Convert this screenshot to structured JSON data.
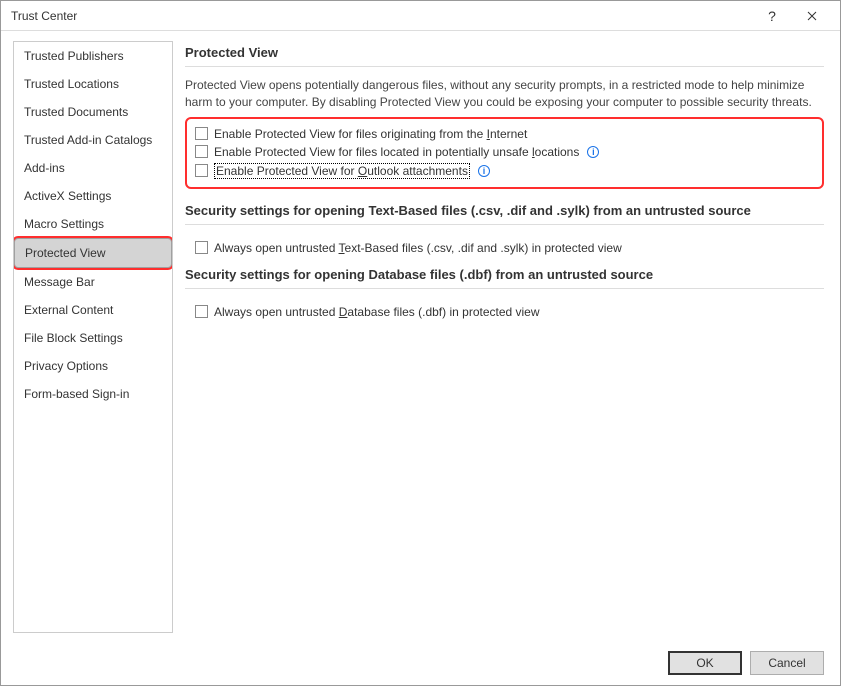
{
  "window": {
    "title": "Trust Center"
  },
  "sidebar": {
    "items": [
      {
        "label": "Trusted Publishers"
      },
      {
        "label": "Trusted Locations"
      },
      {
        "label": "Trusted Documents"
      },
      {
        "label": "Trusted Add-in Catalogs"
      },
      {
        "label": "Add-ins"
      },
      {
        "label": "ActiveX Settings"
      },
      {
        "label": "Macro Settings"
      },
      {
        "label": "Protected View"
      },
      {
        "label": "Message Bar"
      },
      {
        "label": "External Content"
      },
      {
        "label": "File Block Settings"
      },
      {
        "label": "Privacy Options"
      },
      {
        "label": "Form-based Sign-in"
      }
    ]
  },
  "main": {
    "heading": "Protected View",
    "description": "Protected View opens potentially dangerous files, without any security prompts, in a restricted mode to help minimize harm to your computer. By disabling Protected View you could be exposing your computer to possible security threats.",
    "opt1_pre": "Enable Protected View for files originating from the ",
    "opt1_u": "I",
    "opt1_post": "nternet",
    "opt2_pre": "Enable Protected View for files located in potentially unsafe ",
    "opt2_u": "l",
    "opt2_post": "ocations",
    "opt3_pre": "Enable Protected View for ",
    "opt3_u": "O",
    "opt3_post": "utlook attachments",
    "sec2_heading": "Security settings for opening Text-Based files (.csv, .dif and .sylk) from an untrusted source",
    "sec2_opt_pre": "Always open untrusted ",
    "sec2_opt_u": "T",
    "sec2_opt_post": "ext-Based files (.csv, .dif and .sylk) in protected view",
    "sec3_heading": "Security settings for opening Database files (.dbf) from an untrusted source",
    "sec3_opt_pre": "Always open untrusted ",
    "sec3_opt_u": "D",
    "sec3_opt_post": "atabase files (.dbf) in protected view"
  },
  "footer": {
    "ok": "OK",
    "cancel": "Cancel"
  }
}
